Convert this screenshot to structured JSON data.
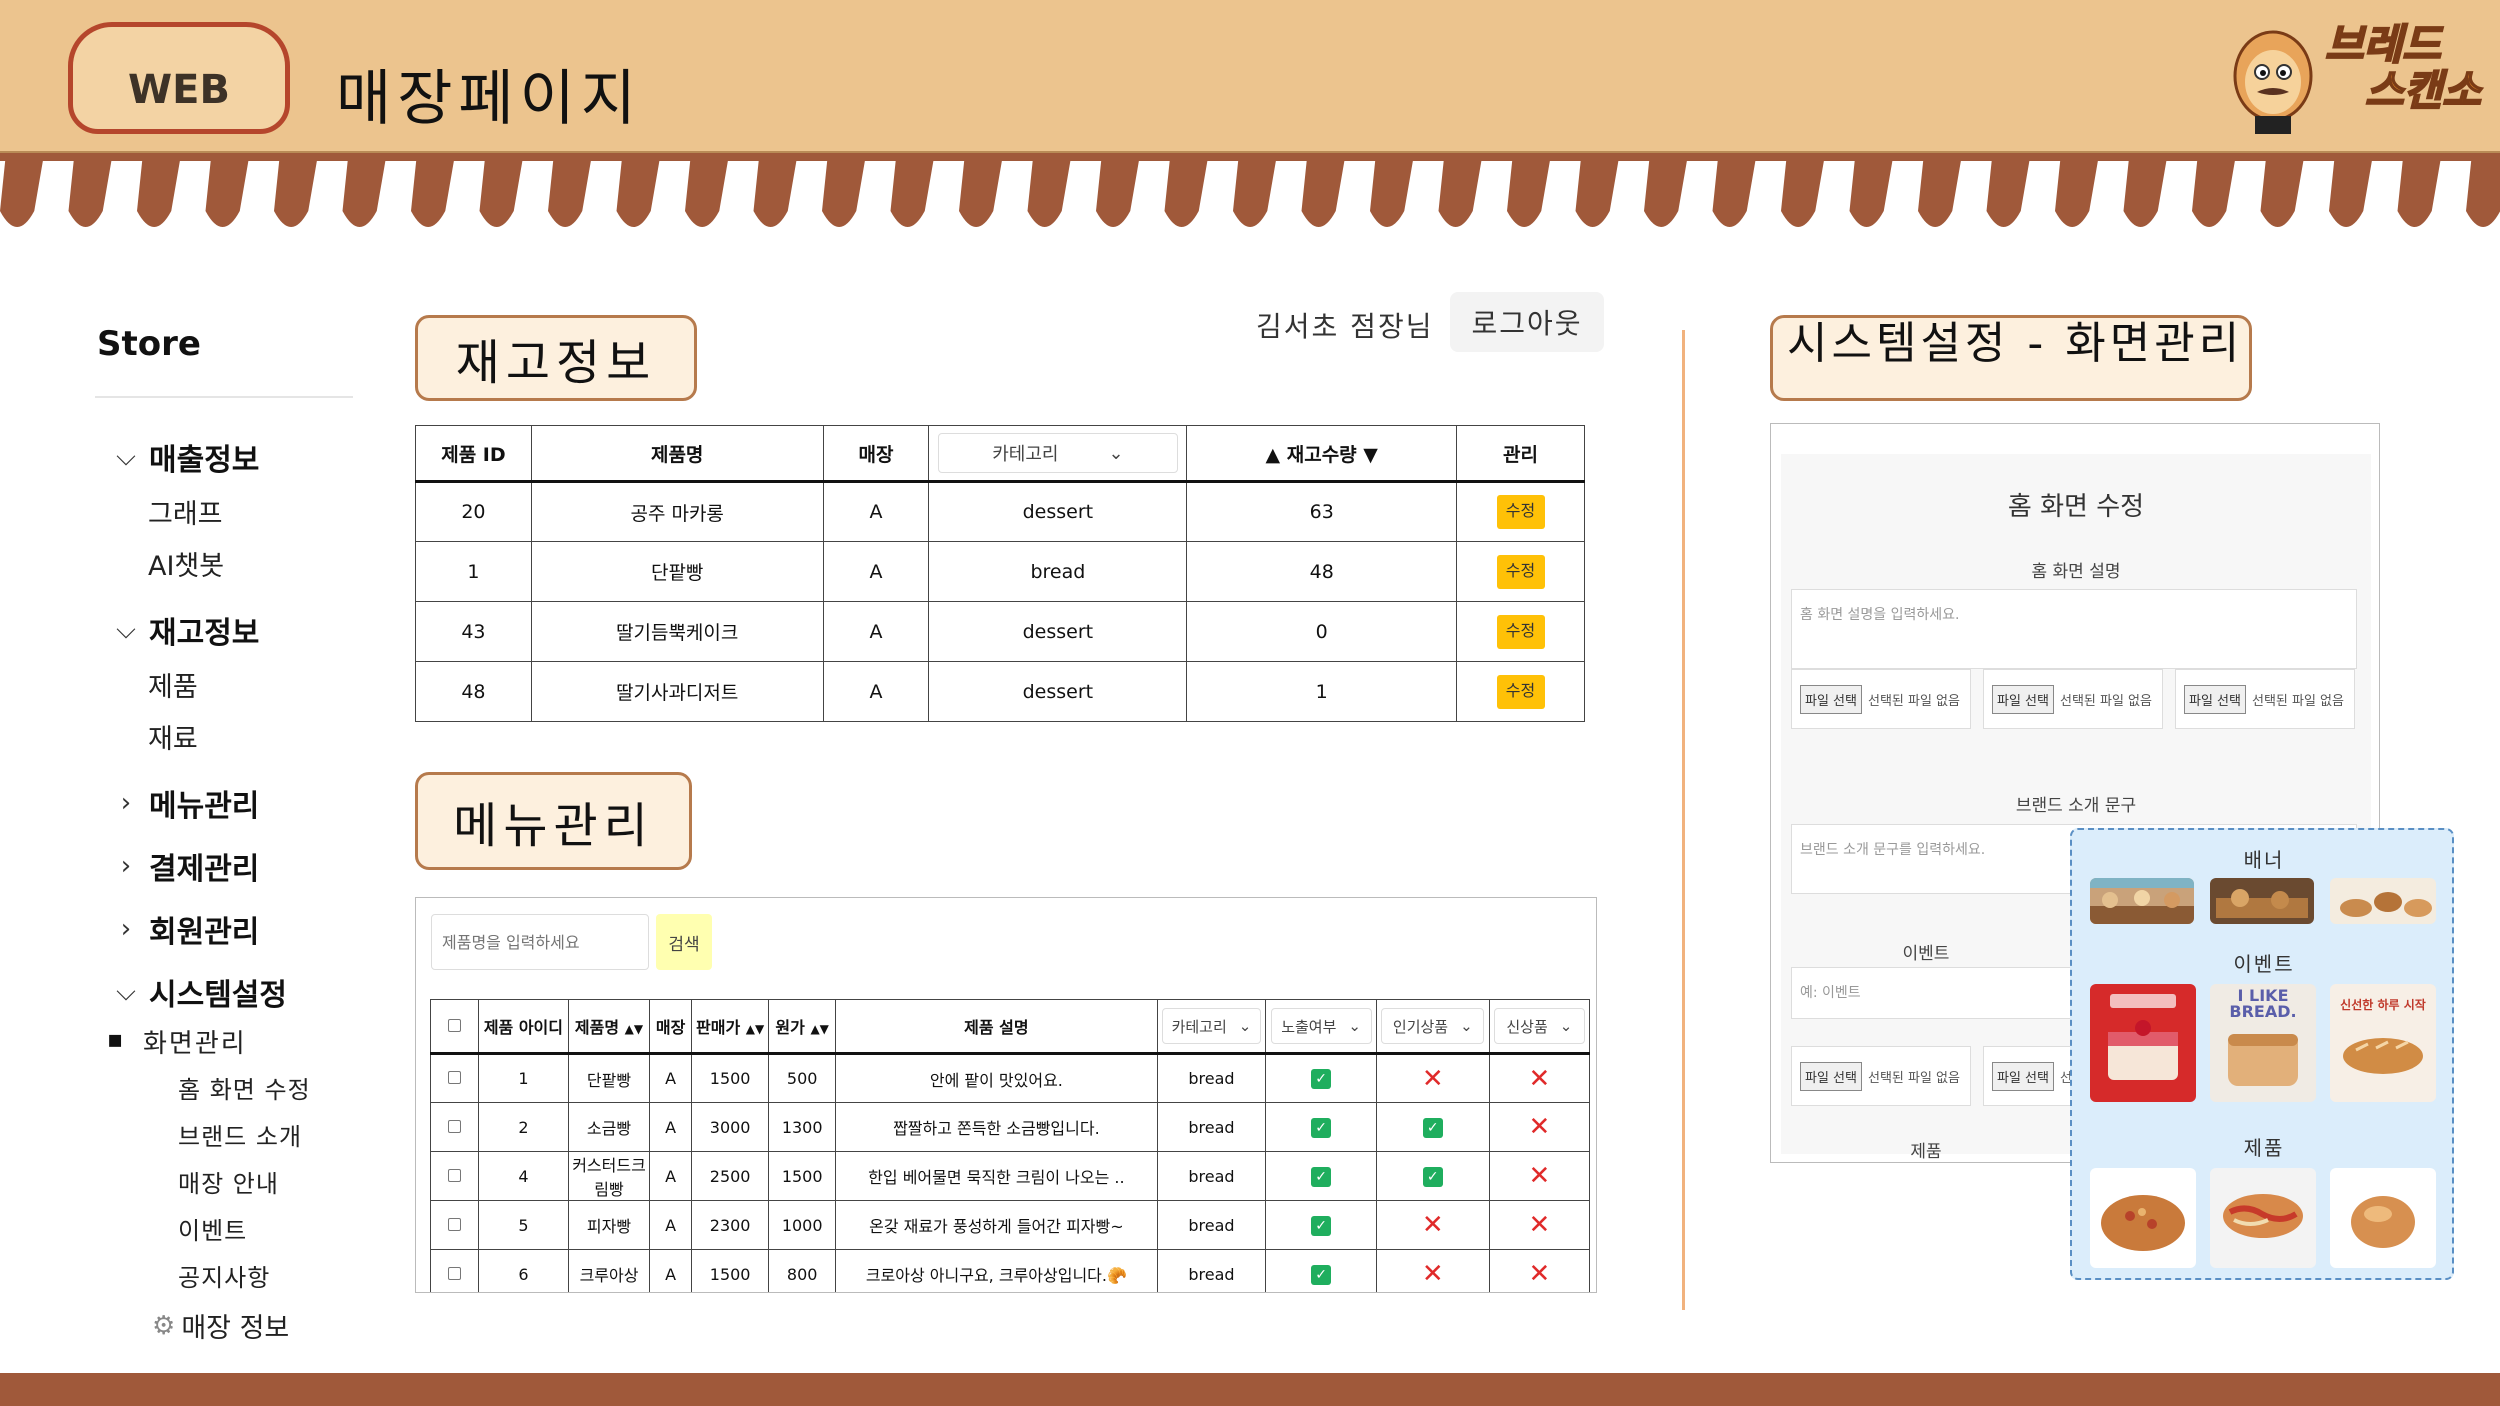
{
  "header": {
    "badge": "WEB",
    "title": "매장페이지",
    "logo_line1": "브레드",
    "logo_line2": "스캔소"
  },
  "sidebar": {
    "store_title": "Store",
    "groups": [
      {
        "label": "매출정보",
        "subs": [
          "그래프",
          "AI챗봇"
        ]
      },
      {
        "label": "재고정보",
        "subs": [
          "제품",
          "재료"
        ]
      },
      {
        "label": "메뉴관리"
      },
      {
        "label": "결제관리"
      },
      {
        "label": "회원관리"
      },
      {
        "label": "시스템설정"
      }
    ],
    "screen_mgmt": "화면관리",
    "screen_subs": [
      "홈 화면 수정",
      "브랜드 소개",
      "매장 안내",
      "이벤트",
      "공지사항"
    ],
    "store_info": "매장 정보"
  },
  "user": {
    "name": "김서초 점장님",
    "logout": "로그아웃"
  },
  "inventory": {
    "section_label": "재고정보",
    "headers": [
      "제품 ID",
      "제품명",
      "매장",
      "카테고리",
      "▲ 재고수량 ▼",
      "관리"
    ],
    "edit_label": "수정",
    "rows": [
      [
        "20",
        "공주 마카롱",
        "A",
        "dessert",
        "63"
      ],
      [
        "1",
        "단팥빵",
        "A",
        "bread",
        "48"
      ],
      [
        "43",
        "딸기듬뿍케이크",
        "A",
        "dessert",
        "0"
      ],
      [
        "48",
        "딸기사과디저트",
        "A",
        "dessert",
        "1"
      ]
    ]
  },
  "menu": {
    "section_label": "메뉴관리",
    "search_placeholder": "제품명을 입력하세요",
    "search_button": "검색",
    "headers": [
      "제품 아이디",
      "제품명",
      "매장",
      "판매가",
      "원가",
      "제품 설명",
      "카테고리",
      "노출여부",
      "인기상품",
      "신상품"
    ],
    "rows": [
      [
        "1",
        "단팥빵",
        "A",
        "1500",
        "500",
        "안에 팥이 맛있어요.",
        "bread"
      ],
      [
        "2",
        "소금빵",
        "A",
        "3000",
        "1300",
        "짭짤하고 쫀득한 소금빵입니다.",
        "bread"
      ],
      [
        "4",
        "커스터드크림빵",
        "A",
        "2500",
        "1500",
        "한입 베어물면 묵직한 크림이 나오는 ..",
        "bread"
      ],
      [
        "5",
        "피자빵",
        "A",
        "2300",
        "1000",
        "온갖 재료가 풍성하게 들어간 피자빵~",
        "bread"
      ],
      [
        "6",
        "크루아상",
        "A",
        "1500",
        "800",
        "크로아상 아니구요, 크루아상입니다.🥐",
        "bread"
      ]
    ],
    "flags": [
      [
        true,
        false,
        false
      ],
      [
        true,
        true,
        false
      ],
      [
        true,
        true,
        false
      ],
      [
        true,
        false,
        false
      ],
      [
        true,
        false,
        false
      ]
    ]
  },
  "system": {
    "section_label": "시스템설정 - 화면관리",
    "heading": "홈 화면 수정",
    "home_desc_label": "홈 화면 설명",
    "home_desc_placeholder": "홈 화면 설명을 입력하세요.",
    "file_button": "파일 선택",
    "file_none": "선택된 파일 없음",
    "brand_label": "브랜드 소개 문구",
    "brand_placeholder": "브랜드 소개 문구를 입력하세요.",
    "event_label": "이벤트",
    "event_placeholder": "예: 이벤트",
    "product_label": "제품"
  },
  "preview": {
    "banner": "배너",
    "event": "이벤트",
    "product": "제품",
    "event_text_1": "I LIKE BREAD.",
    "event_text_2": "신선한 하루 시작"
  }
}
